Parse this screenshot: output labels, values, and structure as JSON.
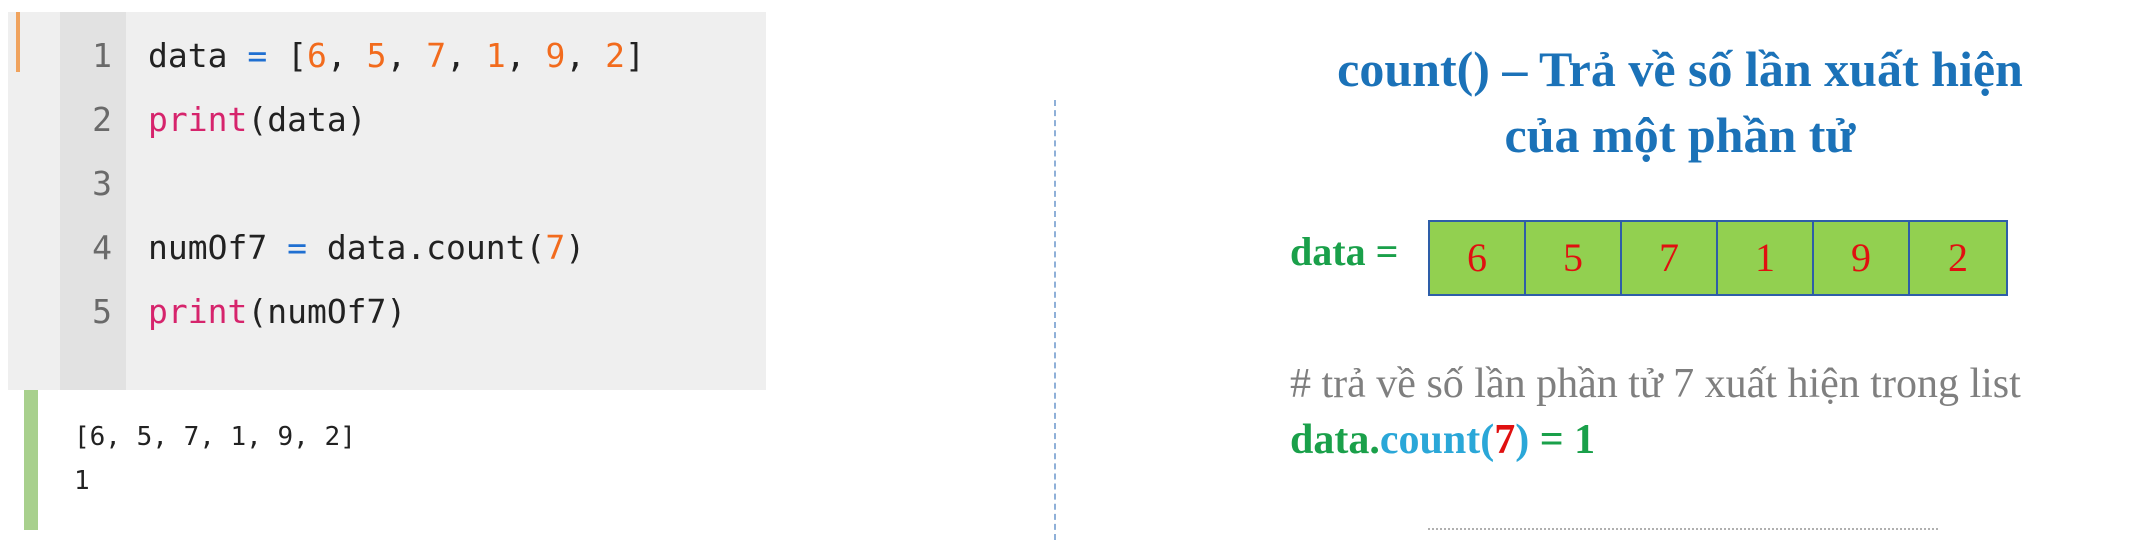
{
  "editor": {
    "lines": [
      {
        "number": "1",
        "tokens": [
          {
            "t": "data",
            "c": "plain"
          },
          {
            "t": " ",
            "c": "plain"
          },
          {
            "t": "=",
            "c": "op"
          },
          {
            "t": " [",
            "c": "plain"
          },
          {
            "t": "6",
            "c": "num"
          },
          {
            "t": ", ",
            "c": "plain"
          },
          {
            "t": "5",
            "c": "num"
          },
          {
            "t": ", ",
            "c": "plain"
          },
          {
            "t": "7",
            "c": "num"
          },
          {
            "t": ", ",
            "c": "plain"
          },
          {
            "t": "1",
            "c": "num"
          },
          {
            "t": ", ",
            "c": "plain"
          },
          {
            "t": "9",
            "c": "num"
          },
          {
            "t": ", ",
            "c": "plain"
          },
          {
            "t": "2",
            "c": "num"
          },
          {
            "t": "]",
            "c": "plain"
          }
        ]
      },
      {
        "number": "2",
        "tokens": [
          {
            "t": "print",
            "c": "kw"
          },
          {
            "t": "(data)",
            "c": "plain"
          }
        ]
      },
      {
        "number": "3",
        "tokens": []
      },
      {
        "number": "4",
        "tokens": [
          {
            "t": "numOf7",
            "c": "plain"
          },
          {
            "t": " ",
            "c": "plain"
          },
          {
            "t": "=",
            "c": "op"
          },
          {
            "t": " data.count(",
            "c": "plain"
          },
          {
            "t": "7",
            "c": "num"
          },
          {
            "t": ")",
            "c": "plain"
          }
        ]
      },
      {
        "number": "5",
        "tokens": [
          {
            "t": "print",
            "c": "kw"
          },
          {
            "t": "(numOf7)",
            "c": "plain"
          }
        ]
      }
    ]
  },
  "output": {
    "lines": [
      "[6, 5, 7, 1, 9, 2]",
      "1"
    ]
  },
  "slide": {
    "title_line1": "count() – Trả về số lần xuất hiện",
    "title_line2": "của một phần tử",
    "array_label": "data =",
    "array_values": [
      "6",
      "5",
      "7",
      "1",
      "9",
      "2"
    ],
    "comment": "# trả về số lần phần tử 7 xuất hiện trong list",
    "expression": {
      "part_data": "data.",
      "part_method": "count(",
      "part_arg": "7",
      "part_close": ")",
      "part_result": " = 1"
    }
  },
  "colors": {
    "title": "#1b72b8",
    "label_green": "#1aa04a",
    "cell_fill": "#92d050",
    "cell_text": "#e01010",
    "comment": "#7f7f7f",
    "keyword": "#d6246c",
    "number": "#f26b1d",
    "operator": "#1f6fd1"
  }
}
